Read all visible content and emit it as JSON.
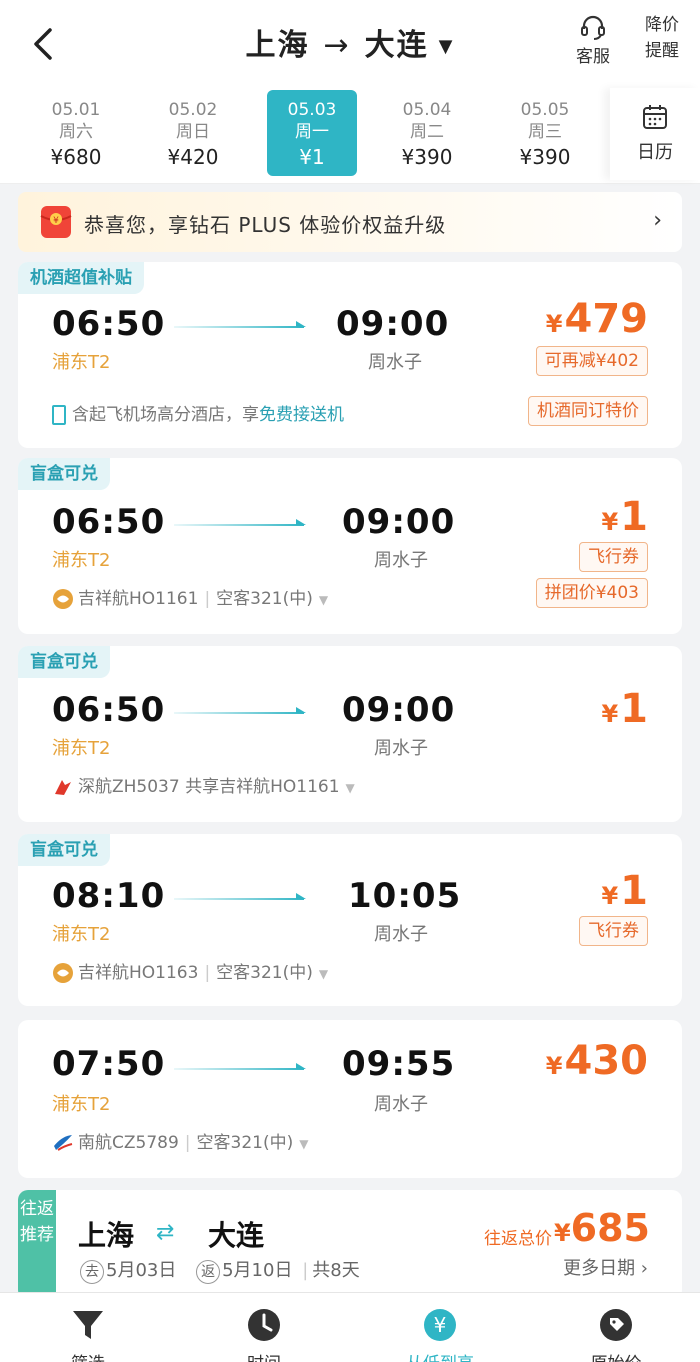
{
  "header": {
    "origin": "上海",
    "destination": "大连",
    "service_label": "客服",
    "price_alert_label_1": "降价",
    "price_alert_label_2": "提醒"
  },
  "dates": [
    {
      "date": "05.01",
      "weekday": "周六",
      "price": "¥680"
    },
    {
      "date": "05.02",
      "weekday": "周日",
      "price": "¥420"
    },
    {
      "date": "05.03",
      "weekday": "周一",
      "price": "¥1",
      "selected": true
    },
    {
      "date": "05.04",
      "weekday": "周二",
      "price": "¥390"
    },
    {
      "date": "05.05",
      "weekday": "周三",
      "price": "¥390"
    }
  ],
  "calendar_label": "日历",
  "banner": {
    "text": "恭喜您，享钻石 PLUS 体验价权益升级"
  },
  "flights": [
    {
      "tag": "机酒超值补贴",
      "dep_time": "06:50",
      "dep_airport": "浦东T2",
      "arr_time": "09:00",
      "arr_airport": "周水子",
      "price_symbol": "¥",
      "price": "479",
      "badge1": "可再减¥402",
      "badge2": "机酒同订特价",
      "info_prefix": "含起飞机场高分酒店，享",
      "info_highlight": "免费接送机"
    },
    {
      "tag": "盲盒可兑",
      "dep_time": "06:50",
      "dep_airport": "浦东T2",
      "arr_time": "09:00",
      "arr_airport": "周水子",
      "price_symbol": "¥",
      "price": "1",
      "badge1": "飞行券",
      "badge2": "拼团价¥403",
      "airline": "吉祥航HO1161",
      "aircraft": "空客321(中)"
    },
    {
      "tag": "盲盒可兑",
      "dep_time": "06:50",
      "dep_airport": "浦东T2",
      "arr_time": "09:00",
      "arr_airport": "周水子",
      "price_symbol": "¥",
      "price": "1",
      "airline": "深航ZH5037 共享吉祥航HO1161"
    },
    {
      "tag": "盲盒可兑",
      "dep_time": "08:10",
      "dep_airport": "浦东T2",
      "arr_time": "10:05",
      "arr_airport": "周水子",
      "price_symbol": "¥",
      "price": "1",
      "badge1": "飞行券",
      "airline": "吉祥航HO1163",
      "aircraft": "空客321(中)"
    },
    {
      "dep_time": "07:50",
      "dep_airport": "浦东T2",
      "arr_time": "09:55",
      "arr_airport": "周水子",
      "price_symbol": "¥",
      "price": "430",
      "airline": "南航CZ5789",
      "aircraft": "空客321(中)"
    }
  ],
  "round_trip": {
    "side_label": "往返推荐",
    "origin": "上海",
    "destination": "大连",
    "go_mark": "去",
    "go_date": "5月03日",
    "return_mark": "返",
    "return_date": "5月10日",
    "duration": "共8天",
    "price_label": "往返总价",
    "price_symbol": "¥",
    "price": "685",
    "more_dates": "更多日期 ›"
  },
  "tabs": [
    {
      "label": "筛选"
    },
    {
      "label": "时间"
    },
    {
      "label": "从低到高",
      "active": true
    },
    {
      "label": "原始价"
    }
  ],
  "colors": {
    "accent": "#2fb5c5",
    "price": "#ef6a24",
    "airport": "#e6a23a"
  }
}
